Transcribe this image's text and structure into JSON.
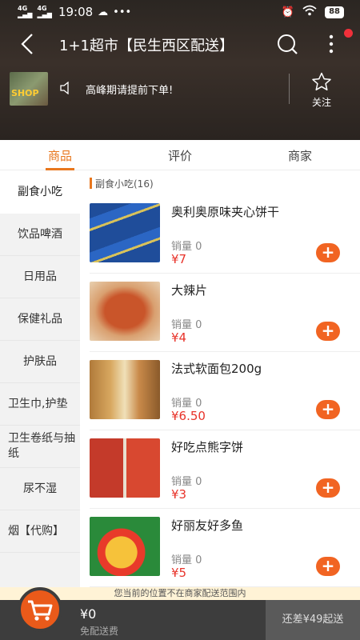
{
  "status_bar": {
    "signal1": "4G HD",
    "signal2": "4G HD",
    "time": "19:08",
    "battery": "88"
  },
  "navbar": {
    "title": "1+1超市【民生西区配送】"
  },
  "shop": {
    "logo_text": "SHOP",
    "notice": "高峰期请提前下单!",
    "follow_label": "关注"
  },
  "tabs": [
    {
      "label": "商品",
      "active": true
    },
    {
      "label": "评价",
      "active": false
    },
    {
      "label": "商家",
      "active": false
    }
  ],
  "sidebar": {
    "items": [
      {
        "label": "副食小吃"
      },
      {
        "label": "饮品啤酒"
      },
      {
        "label": "日用品"
      },
      {
        "label": "保健礼品"
      },
      {
        "label": "护肤品"
      },
      {
        "label": "卫生巾,护垫"
      },
      {
        "label": "卫生卷纸与抽纸"
      },
      {
        "label": "尿不湿"
      },
      {
        "label": "烟【代购】"
      }
    ]
  },
  "category": {
    "header": "副食小吃(16)"
  },
  "products": [
    {
      "name": "奥利奥原味夹心饼干",
      "sales": "销量 0",
      "price": "¥7"
    },
    {
      "name": "大辣片",
      "sales": "销量 0",
      "price": "¥4"
    },
    {
      "name": "法式软面包200g",
      "sales": "销量 0",
      "price": "¥6.50"
    },
    {
      "name": "好吃点熊字饼",
      "sales": "销量 0",
      "price": "¥3"
    },
    {
      "name": "好丽友好多鱼",
      "sales": "销量 0",
      "price": "¥5"
    }
  ],
  "add_label": "+",
  "bottom": {
    "range_tip": "您当前的位置不在商家配送范围内",
    "total": "¥0",
    "free_shipping": "免配送费",
    "checkout": "还差¥49起送"
  },
  "colors": {
    "accent": "#e8771e",
    "price": "#e8332a",
    "add_button": "#f16422",
    "cart": "#ea5a1a"
  }
}
